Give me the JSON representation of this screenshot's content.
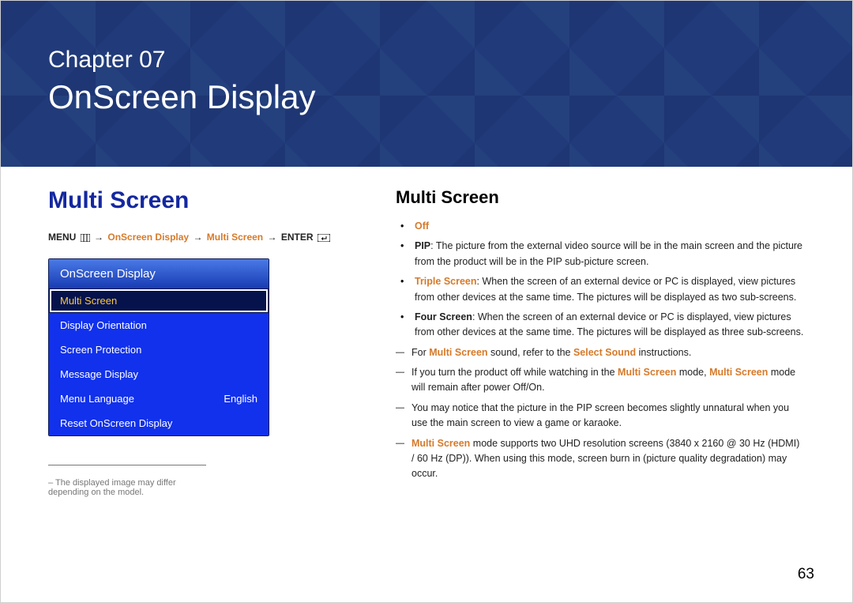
{
  "header": {
    "chapter_label": "Chapter 07",
    "chapter_title": "OnScreen Display"
  },
  "left": {
    "section_heading": "Multi Screen",
    "breadcrumb": {
      "menu": "MENU",
      "seg1": "OnScreen Display",
      "seg2": "Multi Screen",
      "enter": "ENTER"
    },
    "osd": {
      "title": "OnScreen Display",
      "items": [
        {
          "label": "Multi Screen",
          "value": "",
          "selected": true
        },
        {
          "label": "Display Orientation",
          "value": "",
          "selected": false
        },
        {
          "label": "Screen Protection",
          "value": "",
          "selected": false
        },
        {
          "label": "Message Display",
          "value": "",
          "selected": false
        },
        {
          "label": "Menu Language",
          "value": "English",
          "selected": false
        },
        {
          "label": "Reset OnScreen Display",
          "value": "",
          "selected": false
        }
      ]
    },
    "footnote": "The displayed image may differ depending on the model."
  },
  "right": {
    "section_heading": "Multi Screen",
    "bullets": {
      "off": "Off",
      "pip_label": "PIP",
      "pip_text": ": The picture from the external video source will be in the main screen and the picture from the product will be in the PIP sub-picture screen.",
      "triple_label": "Triple Screen",
      "triple_text": ": When the screen of an external device or PC is displayed, view pictures from other devices at the same time. The pictures will be displayed as two sub-screens.",
      "four_label": "Four Screen",
      "four_text": ": When the screen of an external device or PC is displayed, view pictures from other devices at the same time. The pictures will be displayed as three sub-screens."
    },
    "dashes": {
      "d1_pre": "For ",
      "d1_hl1": "Multi Screen",
      "d1_mid": " sound, refer to the ",
      "d1_hl2": "Select Sound",
      "d1_post": " instructions.",
      "d2_pre": "If you turn the product off while watching in the ",
      "d2_hl1": "Multi Screen",
      "d2_mid": " mode, ",
      "d2_hl2": "Multi Screen",
      "d2_post": " mode will remain after power Off/On.",
      "d3": "You may notice that the picture in the PIP screen becomes slightly unnatural when you use the main screen to view a game or karaoke.",
      "d4_hl": "Multi Screen",
      "d4_post": " mode supports two UHD resolution screens (3840 x 2160 @ 30 Hz (HDMI) / 60 Hz (DP)). When using this mode, screen burn in (picture quality degradation) may occur."
    }
  },
  "page_number": "63"
}
